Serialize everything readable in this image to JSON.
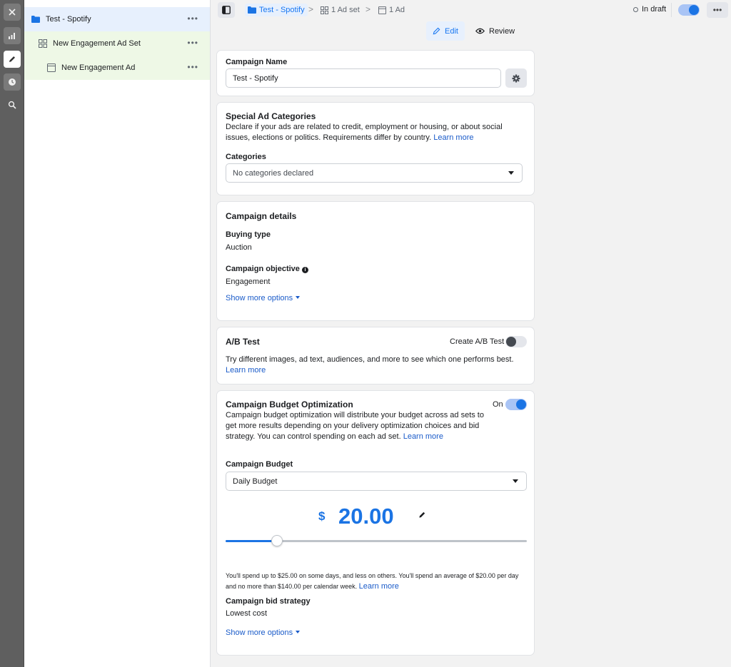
{
  "sidebar_tree": {
    "campaign": {
      "label": "Test - Spotify",
      "more": "•••"
    },
    "adset": {
      "label": "New Engagement Ad Set",
      "more": "•••"
    },
    "ad": {
      "label": "New Engagement Ad",
      "more": "•••"
    }
  },
  "topbar": {
    "breadcrumbs": [
      "Test - Spotify",
      "1 Ad set",
      "1 Ad"
    ],
    "separator": ">",
    "status": "In draft",
    "more": "•••",
    "modes": {
      "edit": "Edit",
      "review": "Review"
    }
  },
  "campaign_name": {
    "label": "Campaign Name",
    "value": "Test - Spotify"
  },
  "special_ad": {
    "heading": "Special Ad Categories",
    "description": "Declare if your ads are related to credit, employment or housing, or about social issues, elections or politics. Requirements differ by country.",
    "link": "Learn more",
    "categories_label": "Categories",
    "categories_value": "No categories declared"
  },
  "campaign_details": {
    "heading": "Campaign details",
    "buying_type_label": "Buying type",
    "buying_type_value": "Auction",
    "objective_label": "Campaign objective",
    "objective_value": "Engagement",
    "show_more": "Show more options"
  },
  "ab_test": {
    "heading": "A/B Test",
    "toggle_label": "Create A/B Test",
    "toggle_on": false,
    "description": "Try different images, ad text, audiences, and more to see which one performs best.",
    "link": "Learn more"
  },
  "cbo": {
    "heading": "Campaign Budget Optimization",
    "toggle_label": "On",
    "toggle_on": true,
    "description": "Campaign budget optimization will distribute your budget across ad sets to get more results depending on your delivery optimization choices and bid strategy. You can control spending on each ad set.",
    "link": "Learn more",
    "budget_label": "Campaign Budget",
    "budget_type": "Daily Budget",
    "currency": "$",
    "amount": "20.00",
    "slider_fraction": 0.17,
    "spend_note": "You'll spend up to $25.00 on some days, and less on others. You'll spend an average of $20.00 per day and no more than $140.00 per calendar week.",
    "spend_link": "Learn more",
    "bid_label": "Campaign bid strategy",
    "bid_value": "Lowest cost",
    "show_more": "Show more options"
  },
  "colors": {
    "accent": "#1b74e4",
    "link": "#1a5bc9",
    "adset_bg": "#eef8e6",
    "campaign_bg": "#e7f0fd"
  }
}
